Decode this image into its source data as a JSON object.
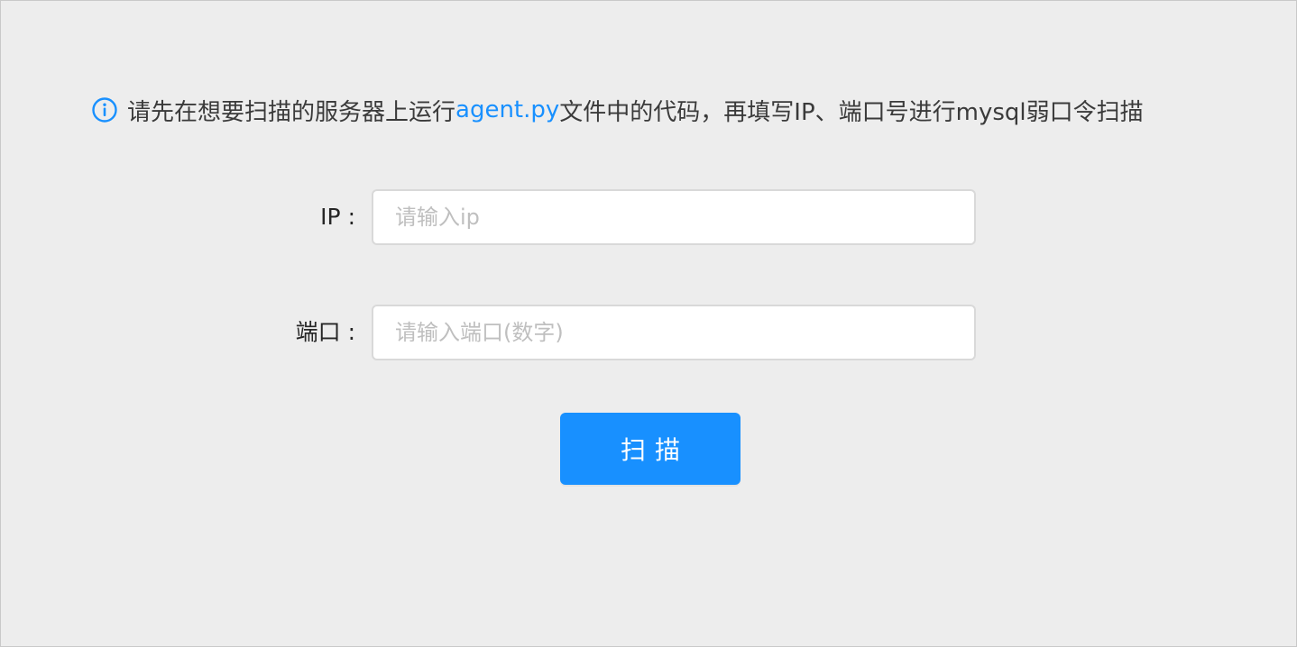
{
  "notice": {
    "text_before": "请先在想要扫描的服务器上运行",
    "link_text": "agent.py",
    "text_after": "文件中的代码，再填写IP、端口号进行mysql弱口令扫描",
    "icon": "info-circle-icon"
  },
  "form": {
    "ip": {
      "label": "IP :",
      "placeholder": "请输入ip",
      "value": ""
    },
    "port": {
      "label": "端口 :",
      "placeholder": "请输入端口(数字)",
      "value": ""
    },
    "submit_label": "扫描"
  },
  "colors": {
    "accent": "#1890ff",
    "background": "#ededed",
    "input_border": "#d9d9d9",
    "placeholder": "#bfbfbf"
  }
}
